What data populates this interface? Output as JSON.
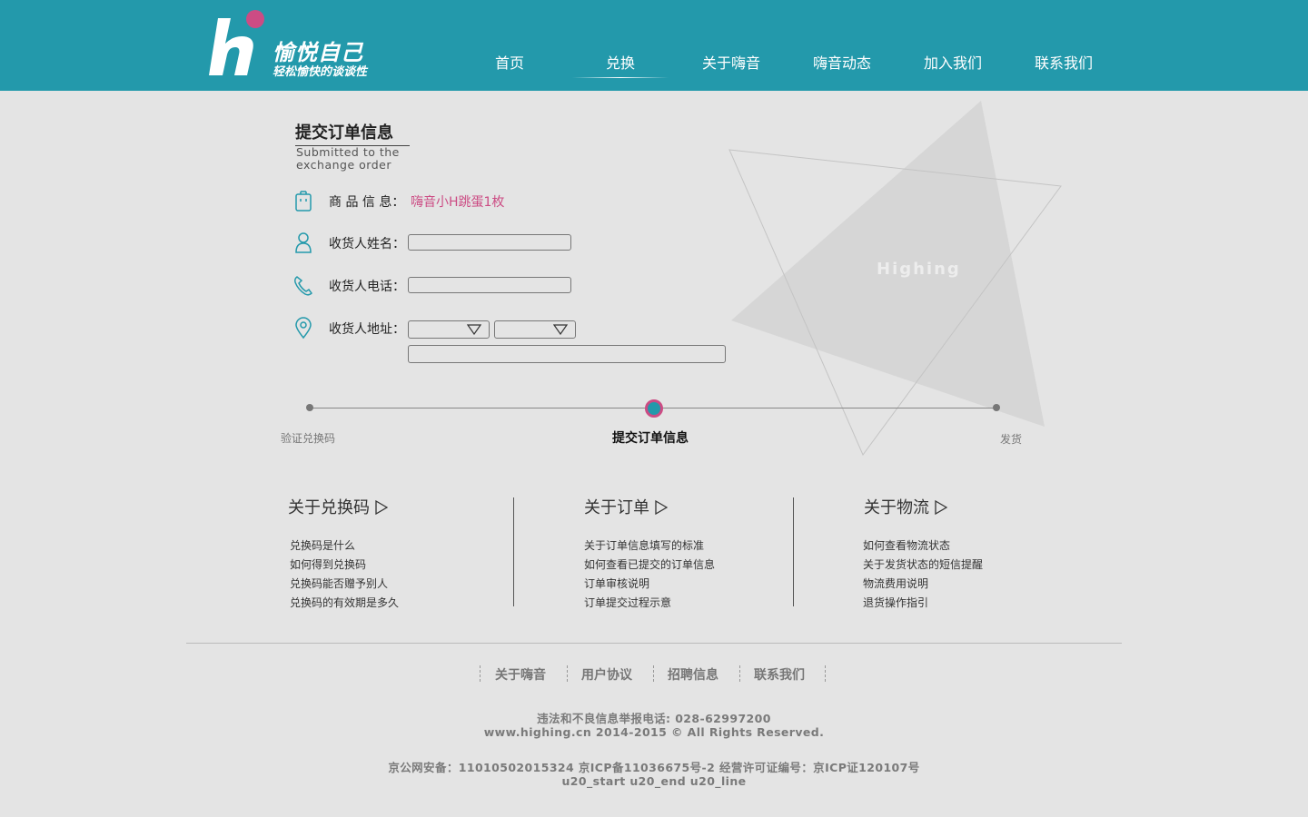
{
  "brand": {
    "title": "愉悦自己",
    "subtitle": "轻松愉快的谈谈性",
    "accent": "#2399ab",
    "dot_color": "#cc4c84"
  },
  "nav": [
    {
      "label": "首页"
    },
    {
      "label": "兑换",
      "active": true
    },
    {
      "label": "关于嗨音"
    },
    {
      "label": "嗨音动态"
    },
    {
      "label": "加入我们"
    },
    {
      "label": "联系我们"
    }
  ],
  "watermark": "Highing",
  "section": {
    "title": "提交订单信息",
    "subtitle": "Submitted to the exchange order"
  },
  "form": {
    "product_label": "商 品 信 息：",
    "product_value": "嗨音小H跳蛋1枚",
    "name_label": "收货人姓名：",
    "phone_label": "收货人电话：",
    "address_label": "收货人地址："
  },
  "steps": [
    {
      "label": "验证兑换码"
    },
    {
      "label": "提交订单信息",
      "active": true
    },
    {
      "label": "发货"
    }
  ],
  "help": [
    {
      "title": "关于兑换码",
      "links": [
        "兑换码是什么",
        "如何得到兑换码",
        "兑换码能否赠予别人",
        "兑换码的有效期是多久"
      ]
    },
    {
      "title": "关于订单",
      "links": [
        "关于订单信息填写的标准",
        "如何查看已提交的订单信息",
        "订单审核说明",
        "订单提交过程示意"
      ]
    },
    {
      "title": "关于物流",
      "links": [
        "如何查看物流状态",
        "关于发货状态的短信提醒",
        "物流费用说明",
        "退货操作指引"
      ]
    }
  ],
  "footer": {
    "links": [
      "关于嗨音",
      "用户协议",
      "招聘信息",
      "联系我们"
    ],
    "report": "违法和不良信息举报电话: 028-62997200",
    "copyright": "www.highing.cn 2014-2015 © All Rights Reserved.",
    "icp": "京公网安备：11010502015324 京ICP备11036675号-2 经营许可证编号：京ICP证120107号",
    "extra": "u20_start u20_end u20_line"
  }
}
